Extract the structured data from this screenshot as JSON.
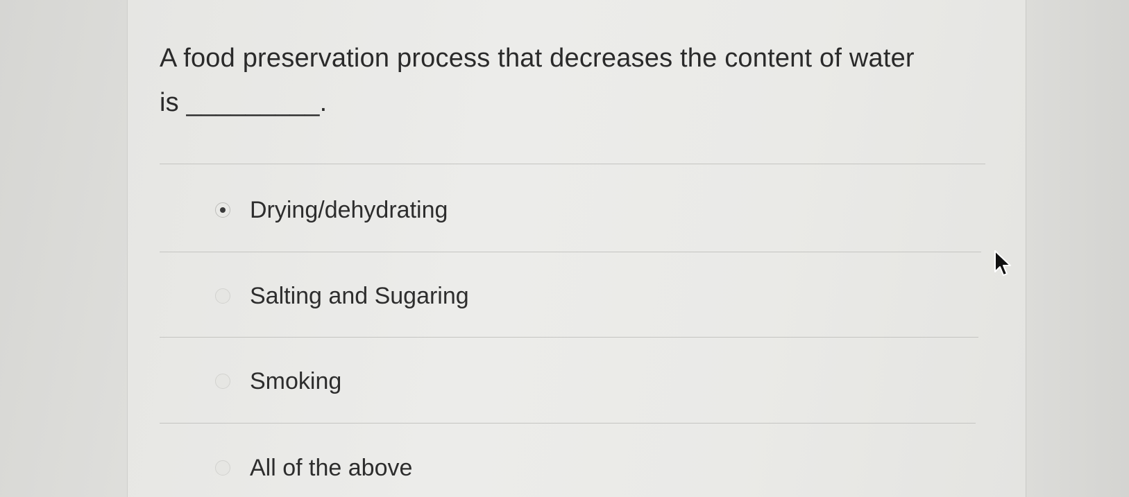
{
  "question": {
    "line1": "A food preservation process that decreases the content of water",
    "line2": "is _________."
  },
  "options": [
    {
      "label": "Drying/dehydrating",
      "selected": true
    },
    {
      "label": "Salting and Sugaring",
      "selected": false
    },
    {
      "label": "Smoking",
      "selected": false
    },
    {
      "label": "All of the above",
      "selected": false
    }
  ],
  "cursor": {
    "icon": "mouse-pointer-icon"
  }
}
